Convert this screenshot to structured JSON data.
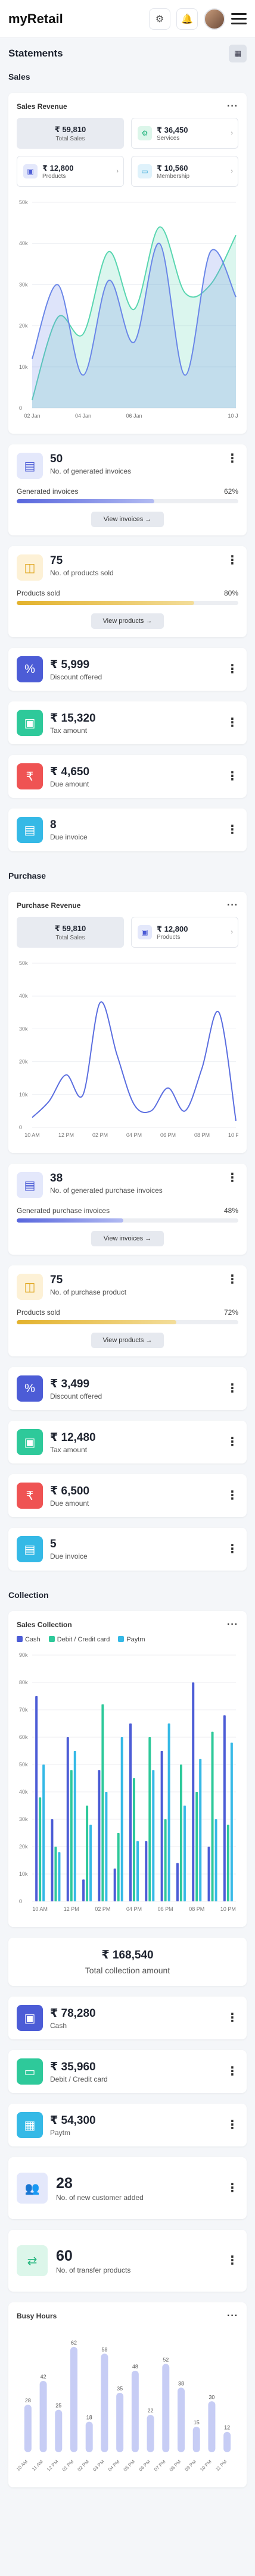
{
  "app": {
    "brand": "myRetail",
    "page_title": "Statements"
  },
  "icons": {
    "settings": "gear-icon",
    "notification": "bell-icon",
    "menu": "hamburger-icon",
    "calendar": "calendar-icon"
  },
  "sales": {
    "section_title": "Sales",
    "card_title": "Sales Revenue",
    "pills": [
      {
        "value": "₹ 59,810",
        "label": "Total Sales"
      },
      {
        "value": "₹ 36,450",
        "label": "Services"
      },
      {
        "value": "₹ 12,800",
        "label": "Products"
      },
      {
        "value": "₹ 10,560",
        "label": "Membership"
      }
    ],
    "invoices": {
      "value": "50",
      "label": "No. of generated invoices",
      "bar_label": "Generated invoices",
      "percent_label": "62%",
      "percent": 62,
      "button": "View invoices →"
    },
    "products": {
      "value": "75",
      "label": "No. of products sold",
      "bar_label": "Products sold",
      "percent_label": "80%",
      "percent": 80,
      "button": "View products →"
    },
    "discount": {
      "value": "₹ 5,999",
      "label": "Discount offered"
    },
    "tax": {
      "value": "₹ 15,320",
      "label": "Tax amount"
    },
    "due": {
      "value": "₹ 4,650",
      "label": "Due amount"
    },
    "due_invoice": {
      "value": "8",
      "label": "Due invoice"
    }
  },
  "purchase": {
    "section_title": "Purchase",
    "card_title": "Purchase Revenue",
    "pills": [
      {
        "value": "₹ 59,810",
        "label": "Total Sales"
      },
      {
        "value": "₹ 12,800",
        "label": "Products"
      }
    ],
    "invoices": {
      "value": "38",
      "label": "No. of generated purchase invoices",
      "bar_label": "Generated purchase invoices",
      "percent_label": "48%",
      "percent": 48,
      "button": "View invoices →"
    },
    "products": {
      "value": "75",
      "label": "No. of purchase product",
      "bar_label": "Products sold",
      "percent_label": "72%",
      "percent": 72,
      "button": "View products →"
    },
    "discount": {
      "value": "₹ 3,499",
      "label": "Discount offered"
    },
    "tax": {
      "value": "₹ 12,480",
      "label": "Tax amount"
    },
    "due": {
      "value": "₹ 6,500",
      "label": "Due amount"
    },
    "due_invoice": {
      "value": "5",
      "label": "Due invoice"
    }
  },
  "collection": {
    "section_title": "Collection",
    "card_title": "Sales Collection",
    "total": {
      "value": "₹ 168,540",
      "label": "Total collection amount"
    },
    "cash": {
      "value": "₹ 78,280",
      "label": "Cash"
    },
    "card": {
      "value": "₹ 35,960",
      "label": "Debit / Credit card"
    },
    "paytm": {
      "value": "₹ 54,300",
      "label": "Paytm"
    },
    "customers": {
      "value": "28",
      "label": "No. of new customer added"
    },
    "transfer": {
      "value": "60",
      "label": "No. of transfer products"
    }
  },
  "busy_hours": {
    "card_title": "Busy Hours"
  },
  "chart_data": [
    {
      "type": "area",
      "x": [
        "02 Jan",
        "03 Jan",
        "04 Jan",
        "05 Jan",
        "06 Jan",
        "07 Jan",
        "08 Jan",
        "09 Jan",
        "10 Jan"
      ],
      "x_ticks": [
        "02 Jan",
        "04 Jan",
        "06 Jan",
        "10 Jan"
      ],
      "series": [
        {
          "values": [
            2,
            22,
            18,
            38,
            24,
            44,
            28,
            30,
            42
          ],
          "color": "#59d6b0"
        },
        {
          "values": [
            12,
            30,
            8,
            31,
            16,
            40,
            8,
            38,
            27
          ],
          "color": "#6a86e8"
        }
      ],
      "ylim": [
        0,
        50
      ],
      "y_ticks": [
        "0",
        "10k",
        "20k",
        "30k",
        "40k",
        "50k"
      ]
    },
    {
      "type": "line",
      "x": [
        "10 AM",
        "11 AM",
        "12 PM",
        "01 PM",
        "02 PM",
        "03 PM",
        "04 PM",
        "05 PM",
        "06 PM",
        "07 PM",
        "08 PM",
        "09 PM",
        "10 PM"
      ],
      "x_ticks": [
        "10 AM",
        "12 PM",
        "02 PM",
        "04 PM",
        "06 PM",
        "08 PM",
        "10 PM"
      ],
      "series": [
        {
          "values": [
            3,
            8,
            16,
            10,
            38,
            22,
            7,
            5,
            12,
            5,
            18,
            35,
            2
          ],
          "color": "#5b6ee0"
        }
      ],
      "ylim": [
        0,
        50
      ],
      "y_ticks": [
        "0",
        "10k",
        "20k",
        "30k",
        "40k",
        "50k"
      ]
    },
    {
      "type": "bar",
      "categories": [
        "10 AM",
        "11 AM",
        "12 PM",
        "01 PM",
        "02 PM",
        "03 PM",
        "04 PM",
        "05 PM",
        "06 PM",
        "07 PM",
        "08 PM",
        "09 PM",
        "10 PM"
      ],
      "x_ticks": [
        "10 AM",
        "12 PM",
        "02 PM",
        "04 PM",
        "06 PM",
        "08 PM",
        "10 PM"
      ],
      "series": [
        {
          "name": "Cash",
          "values": [
            75,
            30,
            60,
            8,
            48,
            12,
            65,
            22,
            55,
            14,
            80,
            20,
            68
          ],
          "color": "#4c5cd6"
        },
        {
          "name": "Debit / Credit card",
          "values": [
            38,
            20,
            48,
            35,
            72,
            25,
            45,
            60,
            30,
            50,
            40,
            62,
            28
          ],
          "color": "#2ec99a"
        },
        {
          "name": "Paytm",
          "values": [
            50,
            18,
            55,
            28,
            40,
            60,
            22,
            48,
            65,
            35,
            52,
            30,
            58
          ],
          "color": "#35b9e6"
        }
      ],
      "ylim": [
        0,
        90
      ],
      "y_ticks": [
        "0",
        "10k",
        "20k",
        "30k",
        "40k",
        "50k",
        "60k",
        "70k",
        "80k",
        "90k"
      ]
    },
    {
      "type": "bar",
      "categories": [
        "10 AM",
        "11 AM",
        "12 PM",
        "01 PM",
        "02 PM",
        "03 PM",
        "04 PM",
        "05 PM",
        "06 PM",
        "07 PM",
        "08 PM",
        "09 PM",
        "10 PM",
        "11 PM"
      ],
      "series": [
        {
          "values": [
            28,
            42,
            25,
            62,
            18,
            58,
            35,
            48,
            22,
            52,
            38,
            15,
            30,
            12
          ],
          "color": "#c7cdf5"
        }
      ],
      "labels": [
        "28",
        "42",
        "25",
        "62",
        "18",
        "58",
        "35",
        "48",
        "22",
        "52",
        "38",
        "15",
        "30",
        "12"
      ],
      "ylim": [
        0,
        70
      ]
    }
  ]
}
